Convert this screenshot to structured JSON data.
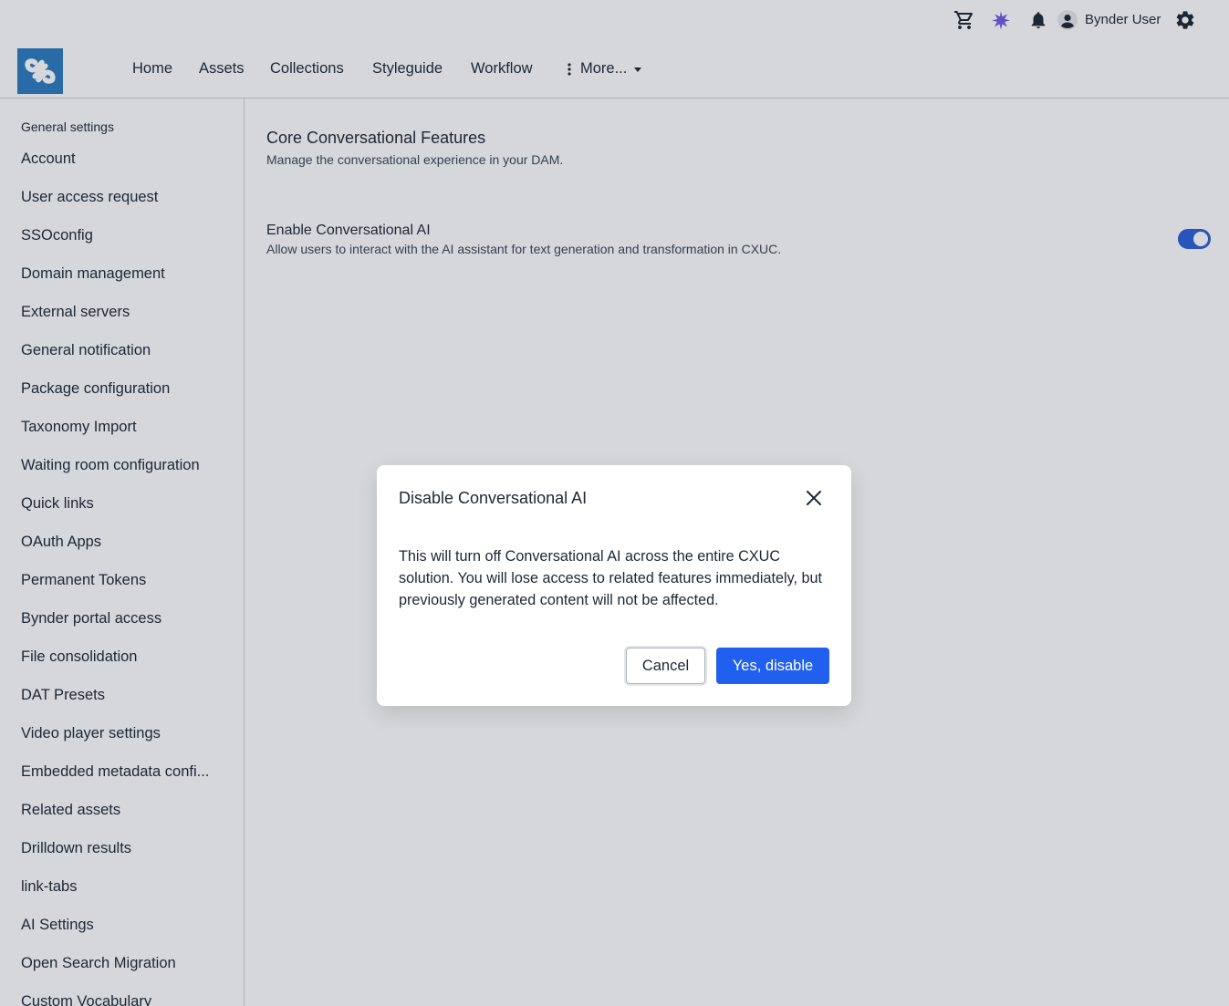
{
  "topbar": {
    "icons": [
      "cart-icon",
      "ai-sparkle-icon",
      "bell-icon",
      "user-avatar-icon",
      "gear-icon"
    ],
    "user_name": "Bynder User"
  },
  "nav": {
    "logo": "bynder-logo",
    "items": [
      "Home",
      "Assets",
      "Collections",
      "Styleguide",
      "Workflow"
    ],
    "more_label": "More..."
  },
  "sidebar": {
    "heading": "General settings",
    "items": [
      "Account",
      "User access request",
      "SSOconfig",
      "Domain management",
      "External servers",
      "General notification",
      "Package configuration",
      "Taxonomy Import",
      "Waiting room configuration",
      "Quick links",
      "OAuth Apps",
      "Permanent Tokens",
      "Bynder portal access",
      "File consolidation",
      "DAT Presets",
      "Video player settings",
      "Embedded metadata confi...",
      "Related assets",
      "Drilldown results",
      "link-tabs",
      "AI Settings",
      "Open Search Migration",
      "Custom Vocabulary"
    ]
  },
  "main": {
    "section_title": "Core Conversational Features",
    "section_desc": "Manage the conversational experience in your DAM.",
    "setting": {
      "title": "Enable Conversational AI",
      "desc": "Allow users to interact with the AI assistant for text generation and transformation in CXUC.",
      "enabled": true
    }
  },
  "modal": {
    "title": "Disable Conversational AI",
    "body": "This will turn off Conversational AI across the entire CXUC solution. You will lose access to related features immediately, but previously generated content will not be affected.",
    "cancel_label": "Cancel",
    "confirm_label": "Yes, disable"
  },
  "colors": {
    "accent": "#2160ef",
    "toggle_on": "#2b5fd9",
    "logo_bg": "#2a7bc0",
    "ai_icon": "#6f5ce6"
  }
}
